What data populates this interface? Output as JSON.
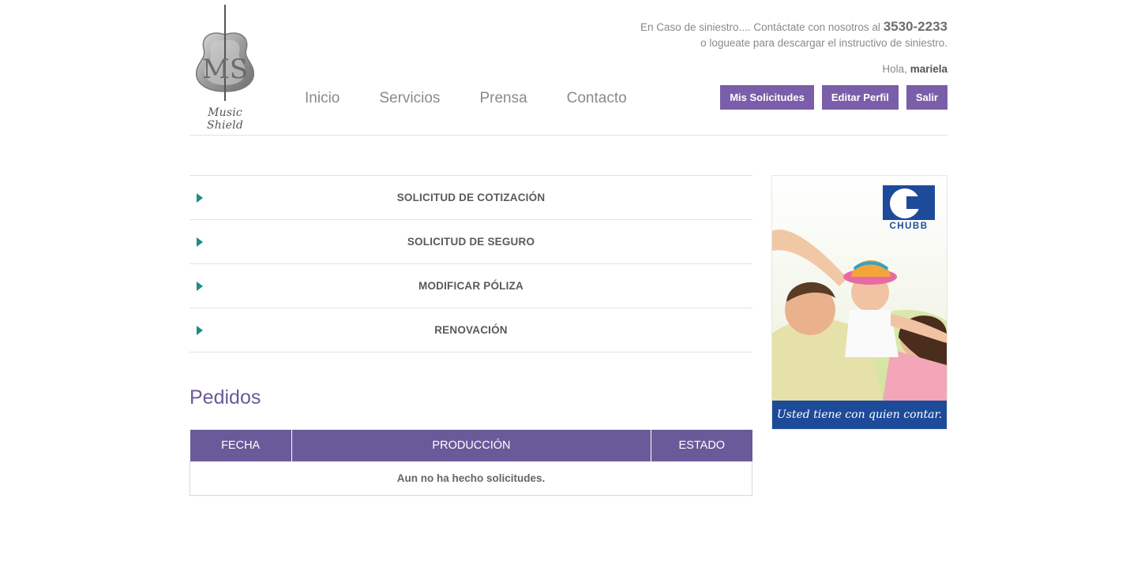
{
  "brand": {
    "name": "Music Shield",
    "initials": "MS"
  },
  "nav": [
    "Inicio",
    "Servicios",
    "Prensa",
    "Contacto"
  ],
  "contact": {
    "line1": "En Caso de siniestro.... Contáctate con nosotros al",
    "phone": "3530-2233",
    "line2": "o logueate para descargar el instructivo de siniestro."
  },
  "user": {
    "greeting": "Hola,",
    "name": "mariela"
  },
  "user_buttons": [
    "Mis Solicitudes",
    "Editar Perfil",
    "Salir"
  ],
  "accordion": [
    "SOLICITUD DE COTIZACIÓN",
    "SOLICITUD DE SEGURO",
    "MODIFICAR PÓLIZA",
    "RENOVACIÓN"
  ],
  "orders": {
    "title": "Pedidos",
    "columns": [
      "FECHA",
      "PRODUCCIÓN",
      "ESTADO"
    ],
    "empty_message": "Aun no ha hecho solicitudes."
  },
  "ad": {
    "brand": "CHUBB",
    "tagline": "Usted tiene con quien contar."
  },
  "colors": {
    "accent": "#7a5ea9",
    "table_header": "#6b5a9a",
    "arrow": "#1a8f80",
    "chubb_blue": "#1d4b9a"
  }
}
